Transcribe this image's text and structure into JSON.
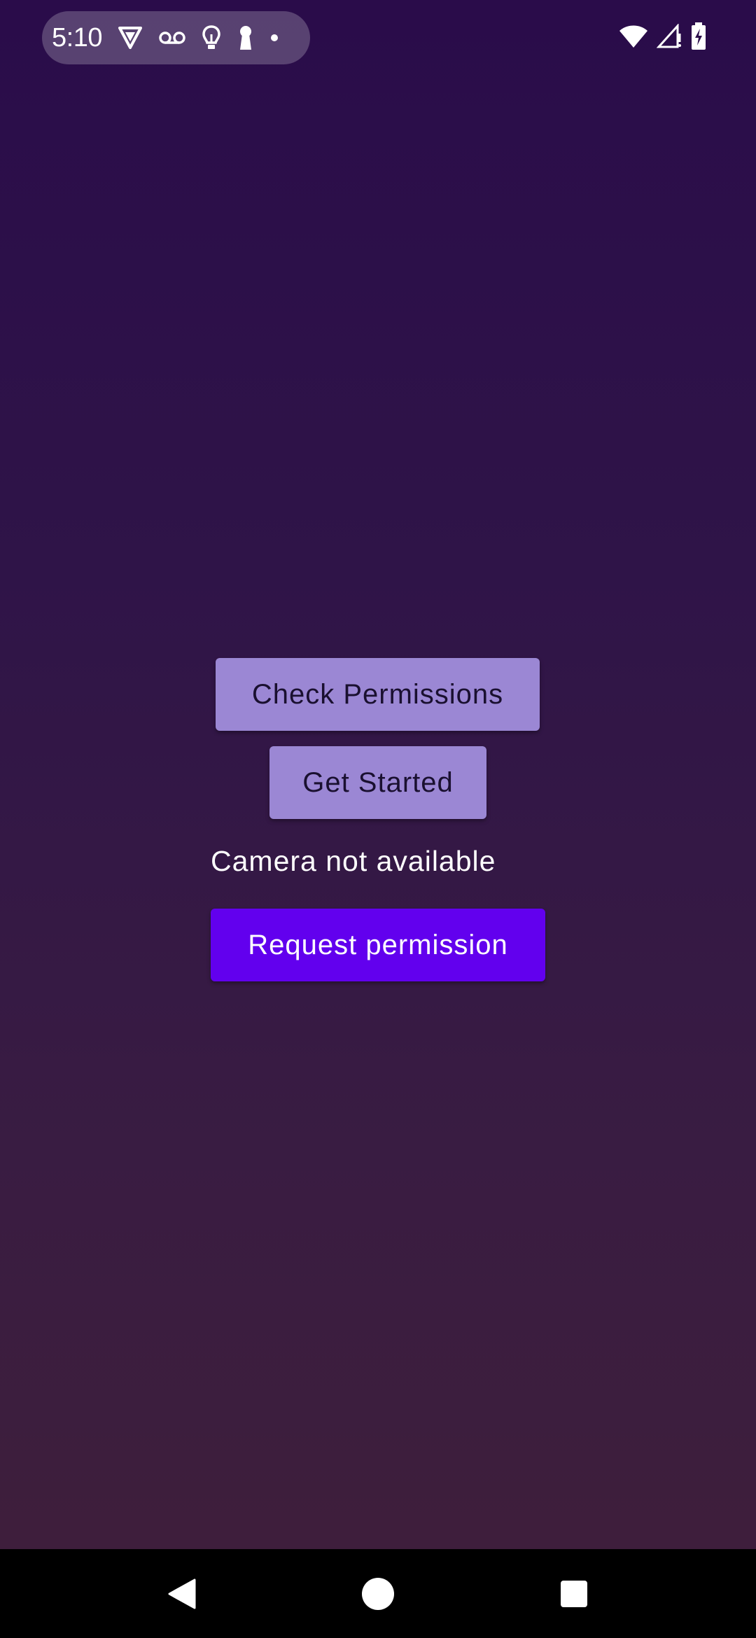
{
  "status_bar": {
    "time": "5:10",
    "left_icons": [
      "vpn-shield-icon",
      "voicemail-icon",
      "lightbulb-icon",
      "keyhole-icon",
      "notification-dot-icon"
    ],
    "right_icons": [
      "wifi-icon",
      "cell-signal-icon",
      "battery-charging-icon"
    ]
  },
  "main": {
    "check_permissions_label": "Check Permissions",
    "get_started_label": "Get Started",
    "camera_status_text": "Camera not available",
    "request_permission_label": "Request permission"
  },
  "nav_bar": {
    "icons": [
      "back-icon",
      "home-icon",
      "recents-icon"
    ]
  },
  "colors": {
    "background_top": "#2a0c4a",
    "background_bottom": "#3f1f3a",
    "light_button": "#9b87d4",
    "primary_button": "#6200ee"
  }
}
